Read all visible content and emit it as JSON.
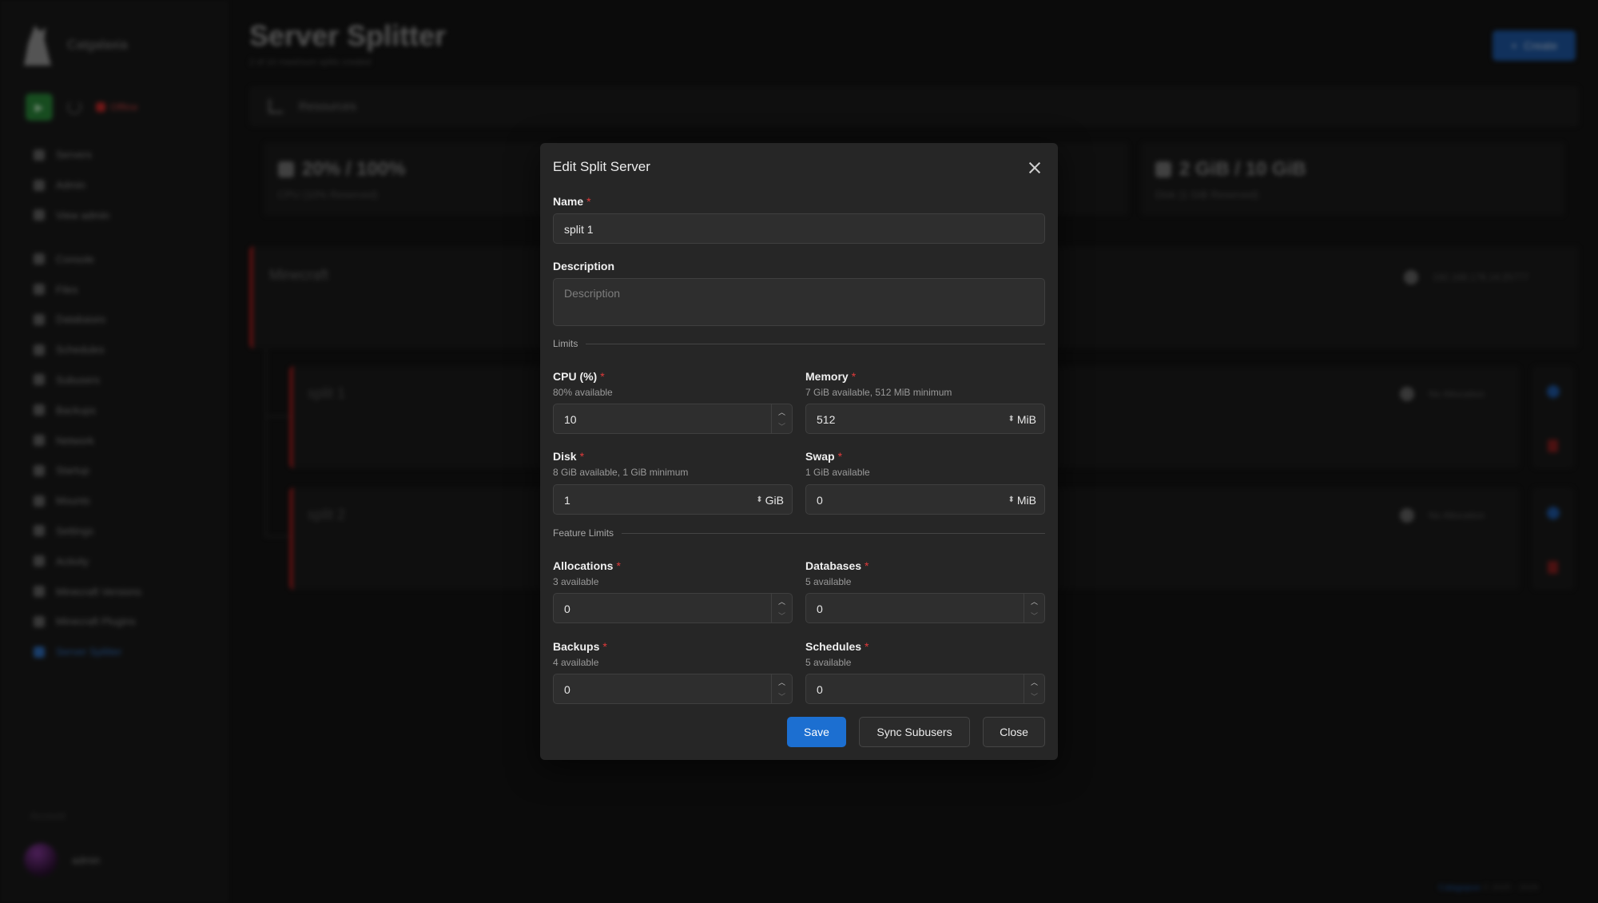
{
  "background": {
    "brand": {
      "name": "Catgalaxia"
    },
    "server_status": "Offline",
    "nav": [
      {
        "label": "Servers",
        "group": 1
      },
      {
        "label": "Admin",
        "group": 1
      },
      {
        "label": "View admin",
        "group": 1
      },
      {
        "label": "Console",
        "group": 2
      },
      {
        "label": "Files",
        "group": 2
      },
      {
        "label": "Databases",
        "group": 2
      },
      {
        "label": "Schedules",
        "group": 2
      },
      {
        "label": "Subusers",
        "group": 2
      },
      {
        "label": "Backups",
        "group": 2
      },
      {
        "label": "Network",
        "group": 2
      },
      {
        "label": "Startup",
        "group": 2
      },
      {
        "label": "Mounts",
        "group": 2
      },
      {
        "label": "Settings",
        "group": 2
      },
      {
        "label": "Activity",
        "group": 2
      },
      {
        "label": "Minecraft Versions",
        "group": 2
      },
      {
        "label": "Minecraft Plugins",
        "group": 2
      },
      {
        "label": "Server Splitter",
        "group": 2,
        "active": true
      }
    ],
    "sidebar_footer_label": "Account",
    "user": {
      "name": "admin"
    },
    "page": {
      "title": "Server Splitter",
      "subtitle": "2 of 10 maximum splits created",
      "create_label": "Create",
      "resources_label": "Resources"
    },
    "stats": [
      {
        "big": "20% / 100%",
        "small": "CPU (10% Reserved)"
      },
      {
        "big": "2 GiB / 10 GiB",
        "small": "Disk (1 GiB Reserved)"
      }
    ],
    "parent_server": {
      "name": "Minecraft",
      "ip": "192.168.178.14:25777"
    },
    "splits": [
      {
        "name": "split 1",
        "allocation": "No Allocation"
      },
      {
        "name": "split 2",
        "allocation": "No Allocation"
      }
    ],
    "footer": {
      "brand": "Calagopus",
      "version": "© 2025 - 2026"
    }
  },
  "modal": {
    "title": "Edit Split Server",
    "close_icon": "close-icon",
    "name": {
      "label": "Name",
      "value": "split 1"
    },
    "description": {
      "label": "Description",
      "placeholder": "Description",
      "value": ""
    },
    "limits_section": "Limits",
    "cpu": {
      "label": "CPU (%)",
      "hint": "80% available",
      "value": "10"
    },
    "memory": {
      "label": "Memory",
      "hint": "7 GiB available, 512 MiB minimum",
      "value": "512",
      "unit": "MiB"
    },
    "disk": {
      "label": "Disk",
      "hint": "8 GiB available, 1 GiB minimum",
      "value": "1",
      "unit": "GiB"
    },
    "swap": {
      "label": "Swap",
      "hint": "1 GiB available",
      "value": "0",
      "unit": "MiB"
    },
    "feature_section": "Feature Limits",
    "allocations": {
      "label": "Allocations",
      "hint": "3 available",
      "value": "0"
    },
    "databases": {
      "label": "Databases",
      "hint": "5 available",
      "value": "0"
    },
    "backups": {
      "label": "Backups",
      "hint": "4 available",
      "value": "0"
    },
    "schedules": {
      "label": "Schedules",
      "hint": "5 available",
      "value": "0"
    },
    "buttons": {
      "save": "Save",
      "sync": "Sync Subusers",
      "close": "Close"
    },
    "colors": {
      "primary": "#1c6fd1",
      "required": "#e03a3a",
      "surface": "#262626"
    }
  }
}
